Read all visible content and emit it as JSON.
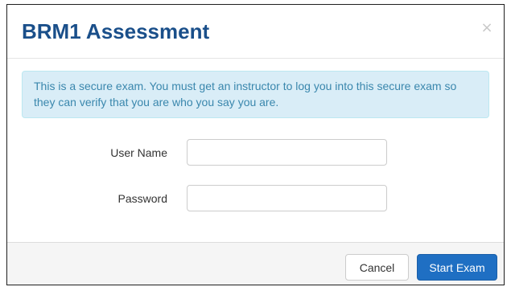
{
  "modal": {
    "title": "BRM1 Assessment",
    "close_glyph": "×"
  },
  "alert": {
    "message": "This is a secure exam. You must get an instructor to log you into this secure exam so they can verify that you are who you say you are."
  },
  "form": {
    "username": {
      "label": "User Name",
      "value": ""
    },
    "password": {
      "label": "Password",
      "value": ""
    }
  },
  "footer": {
    "cancel_label": "Cancel",
    "start_label": "Start Exam"
  },
  "colors": {
    "title": "#1a4f8a",
    "alert_bg": "#d9edf7",
    "alert_text": "#3a87ad",
    "primary_button": "#1f6fc3"
  }
}
